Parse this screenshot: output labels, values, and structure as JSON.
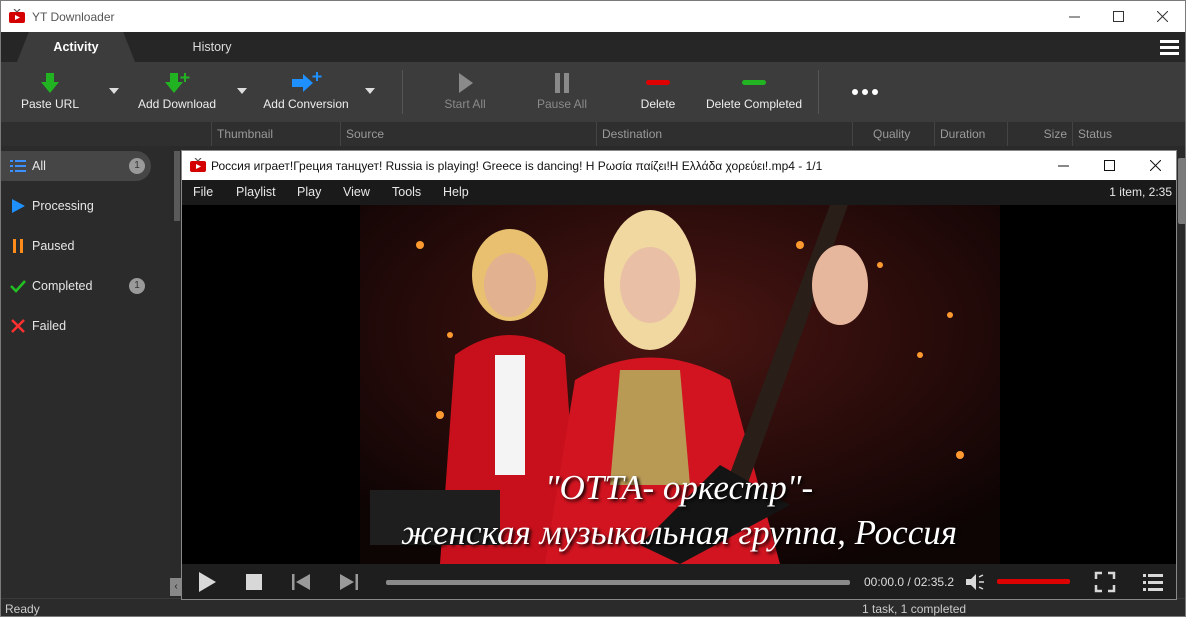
{
  "app": {
    "title": "YT Downloader"
  },
  "tabs": [
    {
      "label": "Activity"
    },
    {
      "label": "History"
    }
  ],
  "toolbar": {
    "paste_url": "Paste URL",
    "add_download": "Add Download",
    "add_conversion": "Add Conversion",
    "start_all": "Start All",
    "pause_all": "Pause All",
    "delete": "Delete",
    "delete_completed": "Delete Completed"
  },
  "columns": [
    "Thumbnail",
    "Source",
    "Destination",
    "Quality",
    "Duration",
    "Size",
    "Status"
  ],
  "sidebar": {
    "items": [
      {
        "label": "All",
        "count": "1"
      },
      {
        "label": "Processing"
      },
      {
        "label": "Paused"
      },
      {
        "label": "Completed",
        "count": "1"
      },
      {
        "label": "Failed"
      }
    ]
  },
  "status": {
    "left": "Ready",
    "right": "1 task, 1 completed"
  },
  "player": {
    "title": "Россия играет!Греция танцует! Russia is playing! Greece is dancing! Η Ρωσία παίζει!Η Ελλάδα χορεύει!.mp4 - 1/1",
    "menu": [
      "File",
      "Playlist",
      "Play",
      "View",
      "Tools",
      "Help"
    ],
    "info": "1 item, 2:35",
    "subtitle_line1": "\"OTTA- оркестр\"-",
    "subtitle_line2": "женская музыкальная группа, Россия",
    "time": "00:00.0 / 02:35.2",
    "progress": 0.0,
    "volume": 1.0
  },
  "colors": {
    "accent_red": "#d00000",
    "play_green": "#22b322",
    "convert_blue": "#1e90ff"
  }
}
